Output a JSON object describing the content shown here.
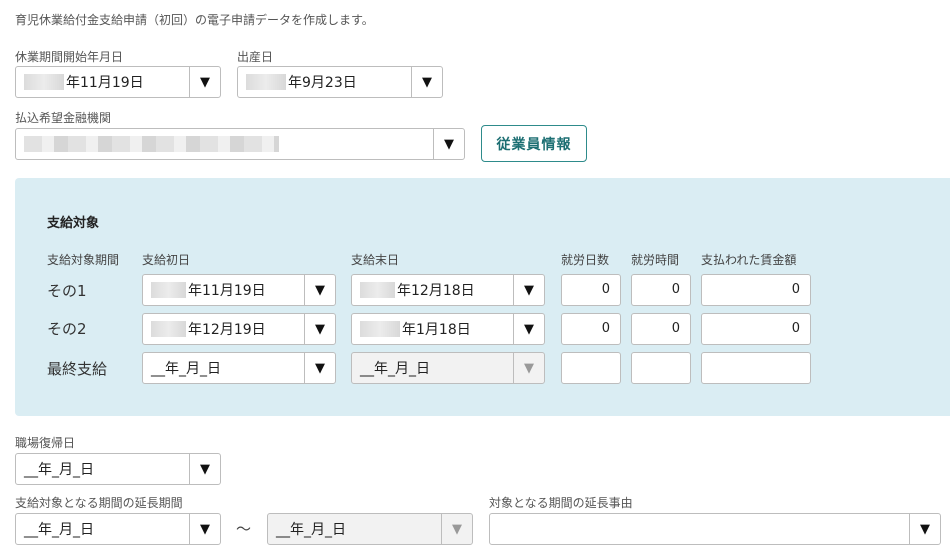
{
  "intro": "育児休業給付金支給申請（初回）の電子申請データを作成します。",
  "leave_start": {
    "label": "休業期間開始年月日",
    "value": "年11月19日"
  },
  "birth_date": {
    "label": "出産日",
    "value": "年9月23日"
  },
  "bank": {
    "label": "払込希望金融機関",
    "value": ""
  },
  "employee_button": "従業員情報",
  "panel": {
    "title": "支給対象",
    "headers": {
      "period": "支給対象期間",
      "start": "支給初日",
      "end": "支給末日",
      "work_days": "就労日数",
      "work_hours": "就労時間",
      "wages": "支払われた賃金額"
    },
    "rows": [
      {
        "label": "その1",
        "start": "年11月19日",
        "end": "年12月18日",
        "days": "0",
        "hours": "0",
        "wages": "0"
      },
      {
        "label": "その2",
        "start": "年12月19日",
        "end": "年1月18日",
        "days": "0",
        "hours": "0",
        "wages": "0"
      },
      {
        "label": "最終支給",
        "start": "__年_月_日",
        "end": "__年_月_日",
        "days": "",
        "hours": "",
        "wages": ""
      }
    ]
  },
  "return_date": {
    "label": "職場復帰日",
    "value": "__年_月_日"
  },
  "extension": {
    "label": "支給対象となる期間の延長期間",
    "from": "__年_月_日",
    "tilde": "～",
    "to": "__年_月_日"
  },
  "extension_reason": {
    "label": "対象となる期間の延長事由",
    "value": ""
  },
  "icons": {
    "dropdown": "▼"
  }
}
